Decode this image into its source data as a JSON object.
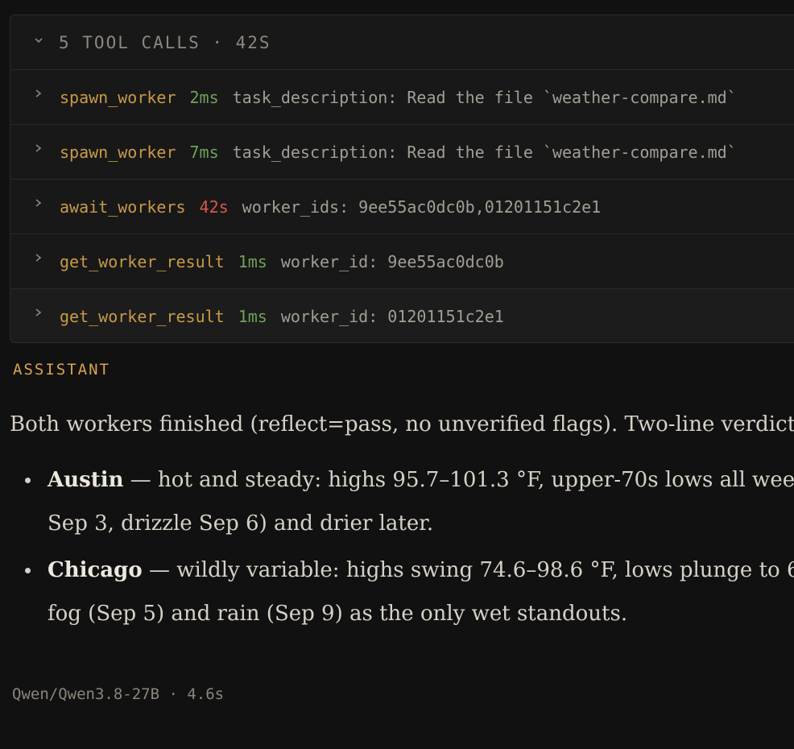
{
  "tool_calls": {
    "header": "5 TOOL CALLS · 42S",
    "rows": [
      {
        "name": "spawn_worker",
        "duration": "2ms",
        "status": "ok",
        "args": "task_description: Read the file `weather-compare.md`"
      },
      {
        "name": "spawn_worker",
        "duration": "7ms",
        "status": "ok",
        "args": "task_description: Read the file `weather-compare.md`"
      },
      {
        "name": "await_workers",
        "duration": "42s",
        "status": "slow",
        "args": "worker_ids: 9ee55ac0dc0b,01201151c2e1"
      },
      {
        "name": "get_worker_result",
        "duration": "1ms",
        "status": "ok",
        "args": "worker_id: 9ee55ac0dc0b"
      },
      {
        "name": "get_worker_result",
        "duration": "1ms",
        "status": "ok",
        "args": "worker_id: 01201151c2e1"
      }
    ]
  },
  "assistant": {
    "role_label": "ASSISTANT",
    "intro": "Both workers finished (reflect=pass, no unverified flags). Two-line verdict",
    "bullets": [
      {
        "city": "Austin",
        "line1": " — hot and steady: highs 95.7–101.3 °F, upper-70s lows all wee",
        "line2": "Sep 3, drizzle Sep 6) and drier later."
      },
      {
        "city": "Chicago",
        "line1": " — wildly variable: highs swing 74.6–98.6 °F, lows plunge to 6",
        "line2": "fog (Sep 5) and rain (Sep 9) as the only wet standouts."
      }
    ]
  },
  "footer": {
    "model_info": "Qwen/Qwen3.8-27B · 4.6s"
  },
  "colors": {
    "background": "#111111",
    "tool_name": "#c99a45",
    "duration_ok": "#6fa25a",
    "duration_slow": "#d9584e",
    "role_label": "#d9a24a"
  }
}
